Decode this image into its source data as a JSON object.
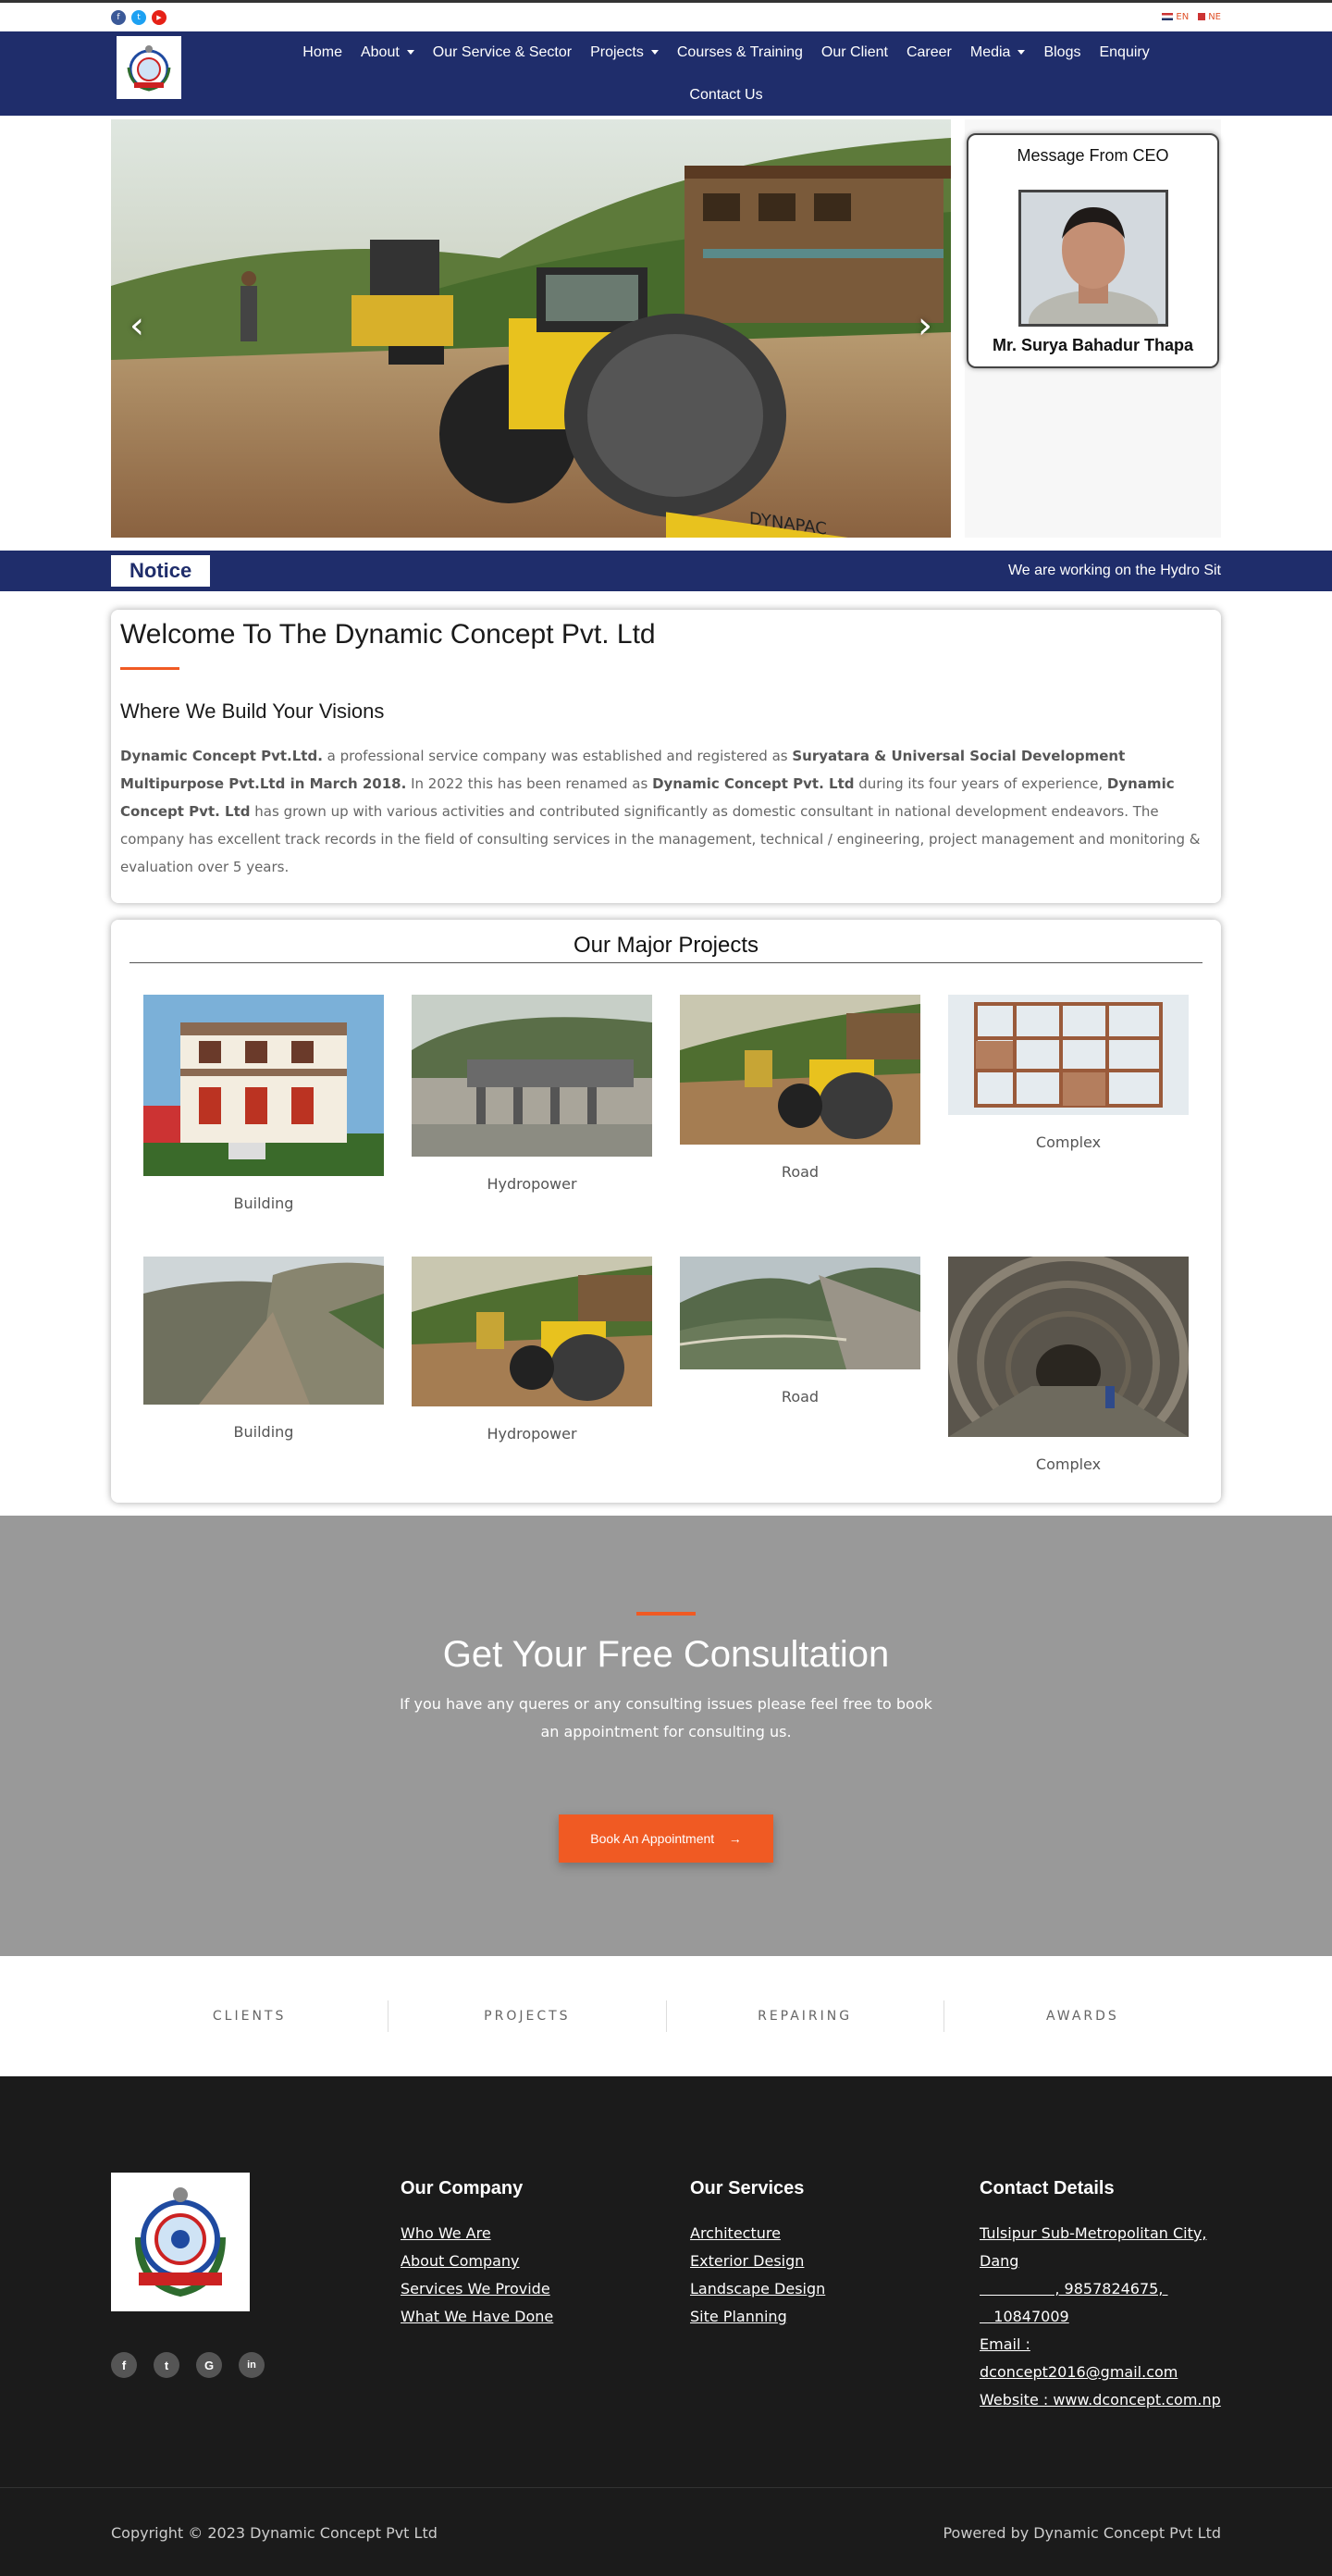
{
  "topbar": {
    "social": [
      {
        "name": "facebook",
        "glyph": "f",
        "color": "#3b5998"
      },
      {
        "name": "twitter",
        "glyph": "t",
        "color": "#1da1f2"
      },
      {
        "name": "youtube",
        "glyph": "▶",
        "color": "#e62117"
      }
    ],
    "languages": [
      "EN",
      "NE"
    ]
  },
  "nav": {
    "items": [
      {
        "label": "Home",
        "dropdown": false
      },
      {
        "label": "About",
        "dropdown": true
      },
      {
        "label": "Our Service & Sector",
        "dropdown": false
      },
      {
        "label": "Projects",
        "dropdown": true
      },
      {
        "label": "Courses & Training",
        "dropdown": false
      },
      {
        "label": "Our Client",
        "dropdown": false
      },
      {
        "label": "Career",
        "dropdown": false
      },
      {
        "label": "Media",
        "dropdown": true
      },
      {
        "label": "Blogs",
        "dropdown": false
      },
      {
        "label": "Enquiry",
        "dropdown": false
      },
      {
        "label": "Contact Us",
        "dropdown": false
      }
    ]
  },
  "hero": {
    "prev_arrow": "‹",
    "next_arrow": "›",
    "ceo_title": "Message From CEO",
    "ceo_name": "Mr. Surya Bahadur Thapa"
  },
  "notice": {
    "label": "Notice",
    "text": "We are working on the Hydro Sit"
  },
  "welcome": {
    "title": "Welcome To The Dynamic Concept Pvt. Ltd",
    "subtitle": "Where We Build Your Visions",
    "p1": "Dynamic Concept Pvt.Ltd.",
    "p2": " a professional service company was established and registered as ",
    "p3": "Suryatara & Universal Social Development Multipurpose Pvt.Ltd in March 2018.",
    "p4": "  In 2022 this has been renamed as ",
    "p5": "Dynamic Concept Pvt. Ltd",
    "p6": " during its four years of experience, ",
    "p7": "Dynamic Concept Pvt. Ltd",
    "p8": " has grown up with various activities and contributed significantly as domestic consultant in national development endeavors. The company has excellent track records in the field of consulting services in the management, technical / engineering, project management and monitoring & evaluation over 5 years."
  },
  "projects": {
    "title": "Our Major Projects",
    "row1": [
      "Building",
      "Hydropower",
      "Road",
      "Complex"
    ],
    "row2": [
      "Building",
      "Hydropower",
      "Road",
      "Complex"
    ]
  },
  "consult": {
    "title": "Get Your Free Consultation",
    "text": "If you have any queres or any consulting issues please feel free to book an appointment for consulting us.",
    "button": "Book An Appointment",
    "button_arrow": "→"
  },
  "stats": [
    "CLIENTS",
    "PROJECTS",
    "REPAIRING",
    "AWARDS"
  ],
  "footer": {
    "social": [
      "f",
      "t",
      "G",
      "in"
    ],
    "company_title": "Our Company",
    "company_links": [
      "Who We Are",
      "About Company",
      "Services We Provide",
      "What We Have Done"
    ],
    "services_title": "Our Services",
    "services_links": [
      "Architecture",
      "Exterior Design",
      "Landscape Design",
      "Site Planning"
    ],
    "contact_title": "Contact Details",
    "contact_lines": [
      "Tulsipur Sub-Metropolitan City, Dang",
      "                , 9857824675, ",
      "   10847009",
      "Email : dconcept2016@gmail.com",
      "Website : www.dconcept.com.np"
    ]
  },
  "copyright": {
    "left": "Copyright © 2023 Dynamic Concept Pvt Ltd",
    "right": "Powered by Dynamic Concept Pvt Ltd"
  }
}
